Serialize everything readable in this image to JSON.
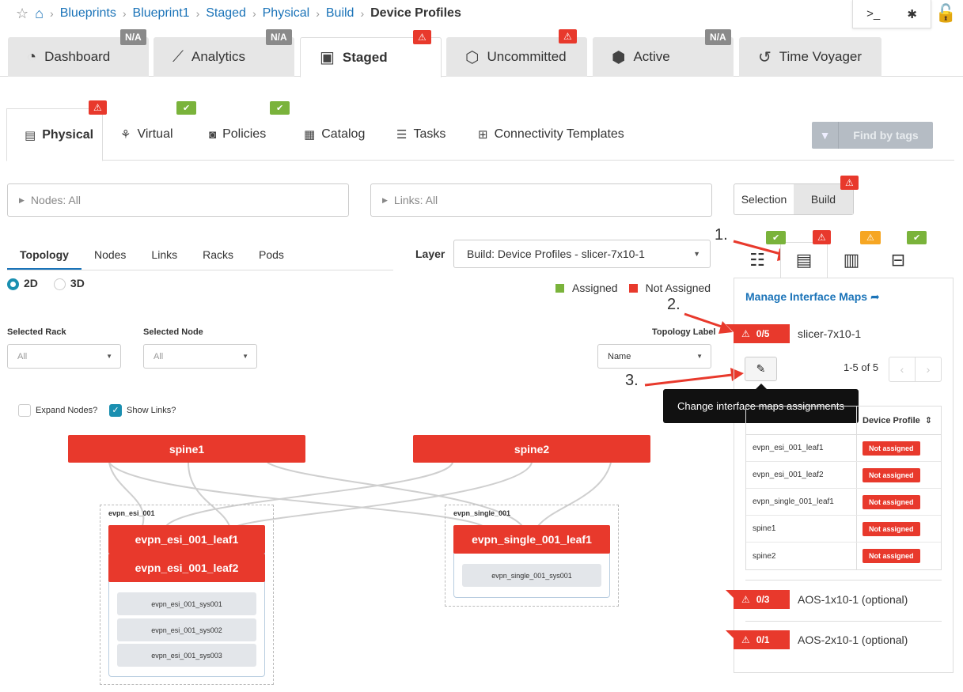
{
  "breadcrumb": {
    "items": [
      "Blueprints",
      "Blueprint1",
      "Staged",
      "Physical",
      "Build"
    ],
    "current": "Device Profiles"
  },
  "top_tabs": [
    {
      "label": "Dashboard",
      "badge": "N/A"
    },
    {
      "label": "Analytics",
      "badge": "N/A"
    },
    {
      "label": "Staged",
      "badge": "⚠"
    },
    {
      "label": "Uncommitted",
      "badge": "⚠"
    },
    {
      "label": "Active",
      "badge": "N/A"
    },
    {
      "label": "Time Voyager"
    }
  ],
  "sub_tabs": [
    {
      "label": "Physical",
      "badge": "⚠"
    },
    {
      "label": "Virtual",
      "badge": "✔"
    },
    {
      "label": "Policies",
      "badge": "✔"
    },
    {
      "label": "Catalog"
    },
    {
      "label": "Tasks"
    },
    {
      "label": "Connectivity Templates"
    }
  ],
  "find_tags": "Find by tags",
  "filters": {
    "nodes": "Nodes: All",
    "links": "Links: All"
  },
  "mode_switch": {
    "selection": "Selection",
    "build": "Build"
  },
  "view_tabs": [
    "Topology",
    "Nodes",
    "Links",
    "Racks",
    "Pods"
  ],
  "view_mode": {
    "two_d": "2D",
    "three_d": "3D"
  },
  "layer": {
    "label": "Layer",
    "value": "Build: Device Profiles - slicer-7x10-1"
  },
  "legend": {
    "assigned": "Assigned",
    "not_assigned": "Not Assigned",
    "assigned_color": "#7ab33b",
    "not_assigned_color": "#e8392c"
  },
  "selectors": {
    "rack_label": "Selected Rack",
    "rack_value": "All",
    "node_label": "Selected Node",
    "node_value": "All",
    "topo_label": "Topology Label",
    "topo_value": "Name"
  },
  "checks": {
    "expand": "Expand Nodes?",
    "show_links": "Show Links?"
  },
  "topology": {
    "spine1": "spine1",
    "spine2": "spine2",
    "rack_esi": "evpn_esi_001",
    "rack_single": "evpn_single_001",
    "esi_leaf1": "evpn_esi_001_leaf1",
    "esi_leaf2": "evpn_esi_001_leaf2",
    "single_leaf1": "evpn_single_001_leaf1",
    "esi_sys": [
      "evpn_esi_001_sys001",
      "evpn_esi_001_sys002",
      "evpn_esi_001_sys003"
    ],
    "single_sys": "evpn_single_001_sys001"
  },
  "side": {
    "manage_link": "Manage Interface Maps",
    "maps": [
      {
        "count": "0/5",
        "name": "slicer-7x10-1"
      },
      {
        "count": "0/3",
        "name": "AOS-1x10-1 (optional)"
      },
      {
        "count": "0/1",
        "name": "AOS-2x10-1 (optional)"
      }
    ],
    "pager": "1-5 of 5",
    "tooltip": "Change interface maps assignments",
    "table_header": "Device Profile",
    "rows": [
      {
        "node": "evpn_esi_001_leaf1",
        "status": "Not assigned"
      },
      {
        "node": "evpn_esi_001_leaf2",
        "status": "Not assigned"
      },
      {
        "node": "evpn_single_001_leaf1",
        "status": "Not assigned"
      },
      {
        "node": "spine1",
        "status": "Not assigned"
      },
      {
        "node": "spine2",
        "status": "Not assigned"
      }
    ]
  },
  "annotations": [
    "1.",
    "2.",
    "3."
  ]
}
